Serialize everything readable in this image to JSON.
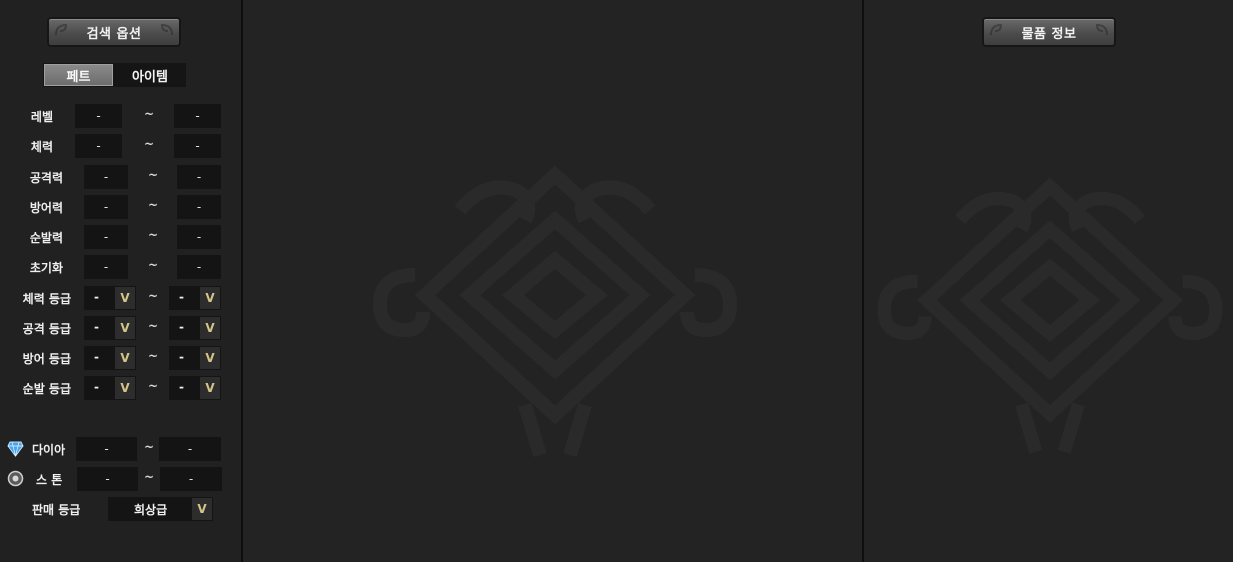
{
  "left": {
    "header": "검색 옵션",
    "tabs": [
      "페트",
      "아이템"
    ],
    "range_rows": [
      {
        "label": "레벨",
        "min": "-",
        "max": "-"
      },
      {
        "label": "체력",
        "min": "-",
        "max": "-"
      },
      {
        "label": "공격력",
        "min": "-",
        "max": "-"
      },
      {
        "label": "방어력",
        "min": "-",
        "max": "-"
      },
      {
        "label": "순발력",
        "min": "-",
        "max": "-"
      },
      {
        "label": "초기화",
        "min": "-",
        "max": "-"
      }
    ],
    "grade_rows": [
      {
        "label": "체력 등급",
        "min": "-",
        "max": "-"
      },
      {
        "label": "공격 등급",
        "min": "-",
        "max": "-"
      },
      {
        "label": "방어 등급",
        "min": "-",
        "max": "-"
      },
      {
        "label": "순발 등급",
        "min": "-",
        "max": "-"
      }
    ],
    "tilde": "~",
    "arrow": "V",
    "currency": [
      {
        "label": "다이아",
        "icon": "diamond-icon",
        "min": "-",
        "max": "-"
      },
      {
        "label": "스 톤",
        "icon": "stone-icon",
        "min": "-",
        "max": "-"
      }
    ],
    "sale_grade": {
      "label": "판매 등급",
      "value": "희상급"
    }
  },
  "right": {
    "header": "물품 정보"
  },
  "colors": {
    "background": "#222222",
    "field": "#141414",
    "divider": "#0e0e0e",
    "button": "#5a5a5a",
    "diamond": "#4aa3e8"
  }
}
